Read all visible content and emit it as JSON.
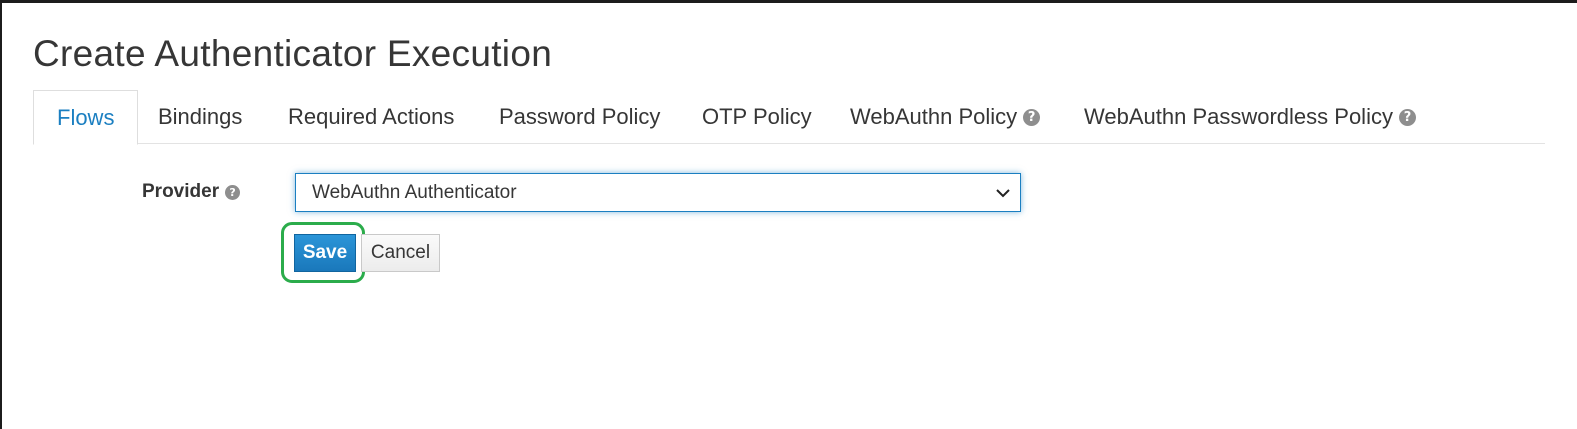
{
  "page": {
    "title": "Create Authenticator Execution"
  },
  "tabs": [
    {
      "label": "Flows",
      "active": true,
      "help": false
    },
    {
      "label": "Bindings",
      "active": false,
      "help": false
    },
    {
      "label": "Required Actions",
      "active": false,
      "help": false
    },
    {
      "label": "Password Policy",
      "active": false,
      "help": false
    },
    {
      "label": "OTP Policy",
      "active": false,
      "help": false
    },
    {
      "label": "WebAuthn Policy",
      "active": false,
      "help": true
    },
    {
      "label": "WebAuthn Passwordless Policy",
      "active": false,
      "help": true
    }
  ],
  "form": {
    "provider_label": "Provider",
    "provider_help_icon": "question-circle-icon",
    "provider_value": "WebAuthn Authenticator"
  },
  "buttons": {
    "save_label": "Save",
    "cancel_label": "Cancel"
  },
  "colors": {
    "accent": "#1b7fc1",
    "primary_button": "#1a78bb",
    "highlight_ring": "#2bac4b"
  },
  "help_glyph": "?"
}
